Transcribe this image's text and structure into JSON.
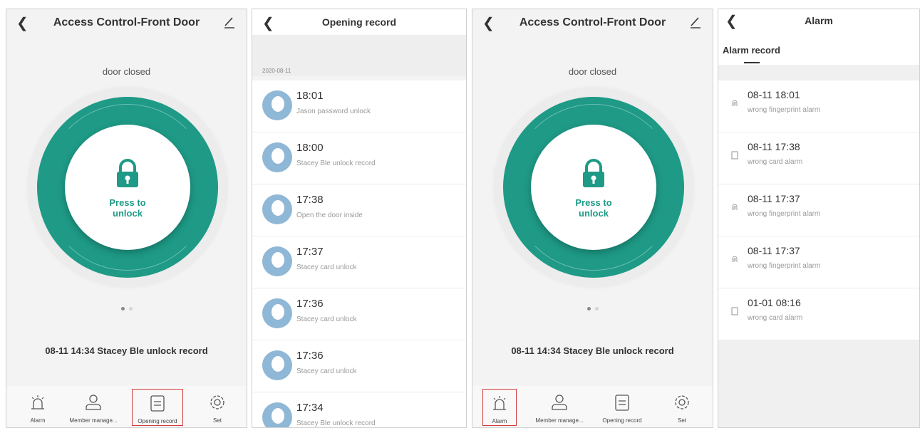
{
  "accent_color": "#1e9a86",
  "selection_color": "#d23b3b",
  "screen1": {
    "back_icon": "chevron-left-icon",
    "title": "Access Control-Front Door",
    "edit_icon": "pencil-icon",
    "door_status": "door closed",
    "unlock_label_line1": "Press to",
    "unlock_label_line2": "unlock",
    "last_record": "08-11 14:34 Stacey Ble unlock record",
    "tabs": [
      {
        "label": "Alarm",
        "icon": "alarm-icon"
      },
      {
        "label": "Member manage...",
        "icon": "person-icon"
      },
      {
        "label": "Opening record",
        "icon": "list-icon"
      },
      {
        "label": "Set",
        "icon": "gear-icon"
      }
    ],
    "selected_tab": "Opening record"
  },
  "screen2": {
    "title": "Opening record",
    "date": "2020-08-11",
    "records": [
      {
        "time": "18:01",
        "desc": "Jason password unlock"
      },
      {
        "time": "18:00",
        "desc": "Stacey Ble unlock record"
      },
      {
        "time": "17:38",
        "desc": "Open the door inside"
      },
      {
        "time": "17:37",
        "desc": "Stacey card unlock"
      },
      {
        "time": "17:36",
        "desc": "Stacey card unlock"
      },
      {
        "time": "17:36",
        "desc": "Stacey card unlock"
      },
      {
        "time": "17:34",
        "desc": "Stacey Ble unlock record"
      }
    ]
  },
  "screen3": {
    "title": "Access Control-Front Door",
    "door_status": "door closed",
    "unlock_label_line1": "Press to",
    "unlock_label_line2": "unlock",
    "last_record": "08-11 14:34 Stacey Ble unlock record",
    "tabs": [
      {
        "label": "Alarm",
        "icon": "alarm-icon"
      },
      {
        "label": "Member manage...",
        "icon": "person-icon"
      },
      {
        "label": "Opening record",
        "icon": "list-icon"
      },
      {
        "label": "Set",
        "icon": "gear-icon"
      }
    ],
    "selected_tab": "Alarm"
  },
  "screen4": {
    "title": "Alarm",
    "subheader": "Alarm record",
    "alarms": [
      {
        "time": "08-11 18:01",
        "desc": "wrong fingerprint alarm",
        "icon": "fingerprint-icon"
      },
      {
        "time": "08-11 17:38",
        "desc": "wrong card alarm",
        "icon": "card-icon"
      },
      {
        "time": "08-11 17:37",
        "desc": "wrong fingerprint alarm",
        "icon": "fingerprint-icon"
      },
      {
        "time": "08-11 17:37",
        "desc": "wrong fingerprint alarm",
        "icon": "fingerprint-icon"
      },
      {
        "time": "01-01 08:16",
        "desc": "wrong card alarm",
        "icon": "card-icon"
      }
    ]
  }
}
